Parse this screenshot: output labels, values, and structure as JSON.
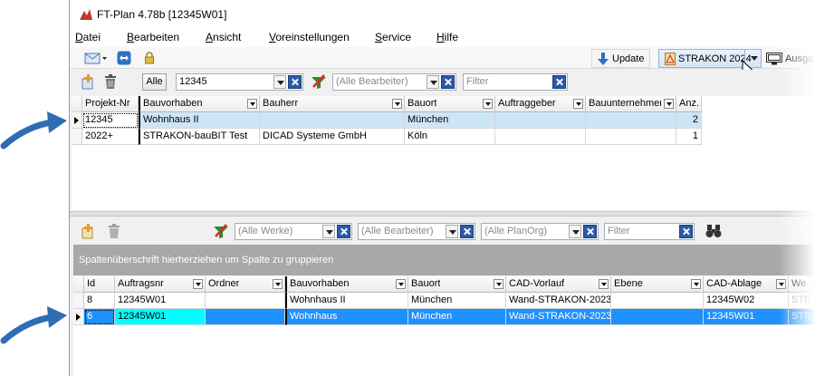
{
  "window": {
    "title": "FT-Plan 4.78b [12345W01]"
  },
  "menu": [
    {
      "u": "D",
      "rest": "atei"
    },
    {
      "u": "B",
      "rest": "earbeiten"
    },
    {
      "u": "A",
      "rest": "nsicht"
    },
    {
      "u": "V",
      "rest": "oreinstellungen"
    },
    {
      "u": "S",
      "rest": "ervice"
    },
    {
      "u": "H",
      "rest": "ilfe"
    }
  ],
  "toolbar": {
    "update_label": "Update",
    "strakon_label": "STRAKON 2024",
    "ausgabe_label": "Ausga"
  },
  "project_filter": {
    "alle_label": "Alle",
    "search_value": "12345",
    "bearbeiter_placeholder": "(Alle Bearbeiter)",
    "filter_placeholder": "Filter"
  },
  "project_grid": {
    "columns": [
      "Projekt-Nr",
      "Bauvorhaben",
      "Bauherr",
      "Bauort",
      "Auftraggeber",
      "Bauunternehmer",
      "Anz."
    ],
    "rows": [
      {
        "projekt_nr": "12345",
        "bauvorhaben": "Wohnhaus II",
        "bauherr": "",
        "bauort": "München",
        "auftraggeber": "",
        "bauunternehmer": "",
        "anz": "2"
      },
      {
        "projekt_nr": "2022+",
        "bauvorhaben": "STRAKON-bauBIT Test",
        "bauherr": "DICAD Systeme GmbH",
        "bauort": "Köln",
        "auftraggeber": "",
        "bauunternehmer": "",
        "anz": "1"
      }
    ]
  },
  "order_filter": {
    "werke_placeholder": "(Alle Werke)",
    "bearbeiter_placeholder": "(Alle Bearbeiter)",
    "planorg_placeholder": "(Alle PlanOrg)",
    "filter_placeholder": "Filter"
  },
  "group_panel": {
    "text": "Spaltenüberschrift hierherziehen um Spalte zu gruppieren"
  },
  "order_grid": {
    "columns": [
      "Id",
      "Auftragsnr",
      "Ordner",
      "Bauvorhaben",
      "Bauort",
      "CAD-Vorlauf",
      "Ebene",
      "CAD-Ablage",
      "We"
    ],
    "rows": [
      {
        "id": "8",
        "auftragsnr": "12345W01",
        "ordner": "",
        "bauvorhaben": "Wohnhaus II",
        "bauort": "München",
        "cad_vorlauf": "Wand-STRAKON-2023-",
        "ebene": "",
        "cad_ablage": "12345W02",
        "we": "STR"
      },
      {
        "id": "6",
        "auftragsnr": "12345W01",
        "ordner": "",
        "bauvorhaben": "Wohnhaus",
        "bauort": "München",
        "cad_vorlauf": "Wand-STRAKON-2023-",
        "ebene": "",
        "cad_ablage": "12345W01",
        "we": "STR"
      }
    ]
  },
  "colors": {
    "selection": "#1e90ff",
    "selection_light": "#cde6f7",
    "focus_cell": "#00ffff",
    "group_panel": "#a8a8a8",
    "arrow": "#2e6db4"
  }
}
